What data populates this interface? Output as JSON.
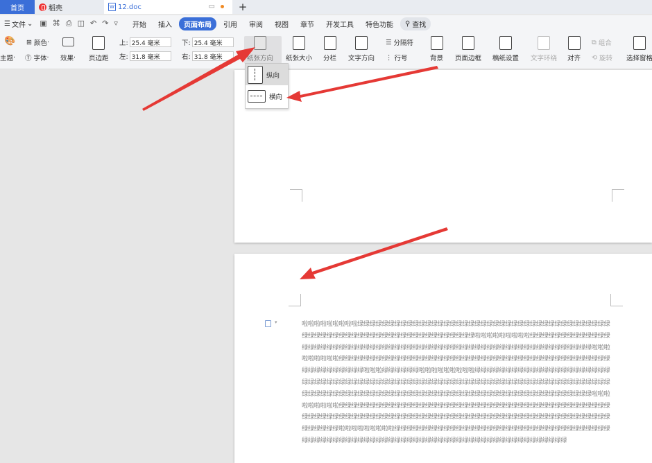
{
  "tabs": {
    "home": "首页",
    "daoke": "稻壳",
    "doc": "12.doc",
    "doc_icon": "W"
  },
  "menu": {
    "file": "文件",
    "items": [
      "开始",
      "插入",
      "页面布局",
      "引用",
      "审阅",
      "视图",
      "章节",
      "开发工具",
      "特色功能"
    ],
    "active": "页面布局",
    "search": "查找"
  },
  "ribbon": {
    "theme": "主题",
    "color": "颜色",
    "font": "字体",
    "effect": "效果",
    "margins": "页边距",
    "top_label": "上:",
    "top_value": "25.4 毫米",
    "bottom_label": "下:",
    "bottom_value": "25.4 毫米",
    "left_label": "左:",
    "left_value": "31.8 毫米",
    "right_label": "右:",
    "right_value": "31.8 毫米",
    "orientation": "纸张方向",
    "size": "纸张大小",
    "columns": "分栏",
    "text_direction": "文字方向",
    "break": "分隔符",
    "line_number": "行号",
    "background": "背景",
    "page_border": "页面边框",
    "manuscript": "稿纸设置",
    "wrap": "文字环绕",
    "align": "对齐",
    "group": "组合",
    "rotate": "旋转",
    "selection_pane": "选择窗格"
  },
  "orientation_menu": {
    "portrait": "纵向",
    "landscape": "横向"
  },
  "document": {
    "body": "啦啦啦啦啦啦啦啦啦绿绿绿绿绿绿绿绿绿绿绿绿绿绿绿绿绿绿绿绿绿绿绿绿绿绿绿绿绿绿绿绿绿绿绿绿绿绿绿绿绿绿绿绿绿绿绿绿绿绿绿绿绿绿绿绿绿绿绿绿绿绿绿绿绿绿绿绿绿啦啦啦啦啦啦啦啦啦绿绿绿绿绿绿绿绿绿绿绿绿绿绿绿绿绿绿绿绿绿绿绿绿绿绿绿绿绿绿绿绿绿绿绿绿绿绿绿绿绿绿绿绿绿绿绿绿绿绿绿绿绿绿绿绿绿绿绿绿啦啦啦啦啦啦啦啦啦绿绿绿绿绿绿绿绿绿绿绿绿绿绿绿绿绿绿绿绿绿绿绿绿绿绿绿绿绿绿绿绿绿绿绿绿绿绿绿绿绿绿绿绿绿绿绿绿绿绿绿绿绿绿啦啦啦绿绿绿绿绿绿啦啦啦啦啦啦啦啦啦绿绿绿绿绿绿绿绿绿绿绿绿绿绿绿绿绿绿绿绿绿绿绿绿绿绿绿绿绿绿绿绿绿绿绿绿绿绿绿绿绿绿绿绿绿绿绿绿绿绿绿绿绿绿绿绿绿绿绿绿绿绿绿绿绿绿绿绿绿绿绿绿绿绿绿绿绿绿绿绿绿绿绿绿绿绿绿绿绿绿绿绿绿绿绿绿绿绿绿绿绿绿绿绿绿绿绿绿绿绿绿绿绿绿绿绿绿绿绿啦啦啦啦啦啦啦啦啦绿绿绿绿绿绿绿绿绿绿绿绿绿绿绿绿绿绿绿绿绿绿绿绿绿绿绿绿绿绿绿绿绿绿绿绿绿绿绿绿绿绿绿绿绿绿绿绿绿绿绿绿绿绿绿绿绿绿绿绿绿绿绿绿绿绿绿绿绿绿绿绿绿绿绿绿绿绿绿绿绿绿绿绿绿绿绿绿绿绿绿绿绿绿绿绿绿绿绿绿啦啦啦啦啦啦啦啦啦绿绿绿绿绿绿绿绿绿绿绿绿绿绿绿绿绿绿绿绿绿绿绿绿绿绿绿绿绿绿绿绿绿绿绿绿绿绿绿绿绿绿绿绿绿绿绿绿绿绿绿绿绿绿绿绿绿绿绿绿绿绿绿绿绿绿绿绿绿绿绿绿绿绿绿绿绿绿"
  },
  "colors": {
    "accent": "#3b6fd8",
    "arrow": "#e53935",
    "tab_bar": "#e9ecf1"
  }
}
